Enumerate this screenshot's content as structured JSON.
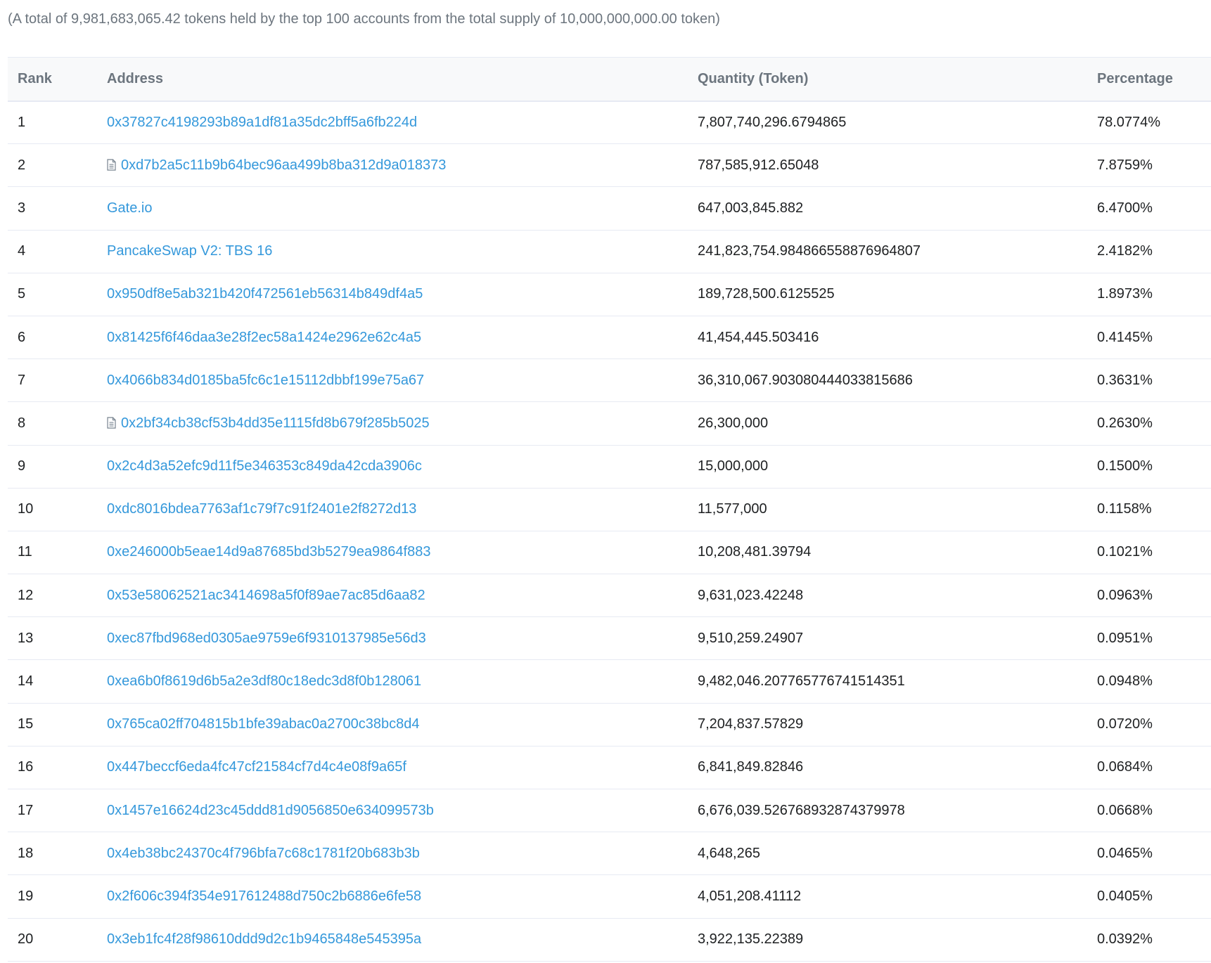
{
  "summary": "(A total of 9,981,683,065.42 tokens held by the top 100 accounts from the total supply of 10,000,000,000.00 token)",
  "table": {
    "headers": {
      "rank": "Rank",
      "address": "Address",
      "quantity": "Quantity (Token)",
      "percentage": "Percentage"
    },
    "rows": [
      {
        "rank": "1",
        "address": "0x37827c4198293b89a1df81a35dc2bff5a6fb224d",
        "contract": false,
        "quantity": "7,807,740,296.6794865",
        "percentage": "78.0774%"
      },
      {
        "rank": "2",
        "address": "0xd7b2a5c11b9b64bec96aa499b8ba312d9a018373",
        "contract": true,
        "quantity": "787,585,912.65048",
        "percentage": "7.8759%"
      },
      {
        "rank": "3",
        "address": "Gate.io",
        "contract": false,
        "quantity": "647,003,845.882",
        "percentage": "6.4700%"
      },
      {
        "rank": "4",
        "address": "PancakeSwap V2: TBS 16",
        "contract": false,
        "quantity": "241,823,754.984866558876964807",
        "percentage": "2.4182%"
      },
      {
        "rank": "5",
        "address": "0x950df8e5ab321b420f472561eb56314b849df4a5",
        "contract": false,
        "quantity": "189,728,500.6125525",
        "percentage": "1.8973%"
      },
      {
        "rank": "6",
        "address": "0x81425f6f46daa3e28f2ec58a1424e2962e62c4a5",
        "contract": false,
        "quantity": "41,454,445.503416",
        "percentage": "0.4145%"
      },
      {
        "rank": "7",
        "address": "0x4066b834d0185ba5fc6c1e15112dbbf199e75a67",
        "contract": false,
        "quantity": "36,310,067.903080444033815686",
        "percentage": "0.3631%"
      },
      {
        "rank": "8",
        "address": "0x2bf34cb38cf53b4dd35e1115fd8b679f285b5025",
        "contract": true,
        "quantity": "26,300,000",
        "percentage": "0.2630%"
      },
      {
        "rank": "9",
        "address": "0x2c4d3a52efc9d11f5e346353c849da42cda3906c",
        "contract": false,
        "quantity": "15,000,000",
        "percentage": "0.1500%"
      },
      {
        "rank": "10",
        "address": "0xdc8016bdea7763af1c79f7c91f2401e2f8272d13",
        "contract": false,
        "quantity": "11,577,000",
        "percentage": "0.1158%"
      },
      {
        "rank": "11",
        "address": "0xe246000b5eae14d9a87685bd3b5279ea9864f883",
        "contract": false,
        "quantity": "10,208,481.39794",
        "percentage": "0.1021%"
      },
      {
        "rank": "12",
        "address": "0x53e58062521ac3414698a5f0f89ae7ac85d6aa82",
        "contract": false,
        "quantity": "9,631,023.42248",
        "percentage": "0.0963%"
      },
      {
        "rank": "13",
        "address": "0xec87fbd968ed0305ae9759e6f9310137985e56d3",
        "contract": false,
        "quantity": "9,510,259.24907",
        "percentage": "0.0951%"
      },
      {
        "rank": "14",
        "address": "0xea6b0f8619d6b5a2e3df80c18edc3d8f0b128061",
        "contract": false,
        "quantity": "9,482,046.207765776741514351",
        "percentage": "0.0948%"
      },
      {
        "rank": "15",
        "address": "0x765ca02ff704815b1bfe39abac0a2700c38bc8d4",
        "contract": false,
        "quantity": "7,204,837.57829",
        "percentage": "0.0720%"
      },
      {
        "rank": "16",
        "address": "0x447beccf6eda4fc47cf21584cf7d4c4e08f9a65f",
        "contract": false,
        "quantity": "6,841,849.82846",
        "percentage": "0.0684%"
      },
      {
        "rank": "17",
        "address": "0x1457e16624d23c45ddd81d9056850e634099573b",
        "contract": false,
        "quantity": "6,676,039.526768932874379978",
        "percentage": "0.0668%"
      },
      {
        "rank": "18",
        "address": "0x4eb38bc24370c4f796bfa7c68c1781f20b683b3b",
        "contract": false,
        "quantity": "4,648,265",
        "percentage": "0.0465%"
      },
      {
        "rank": "19",
        "address": "0x2f606c394f354e917612488d750c2b6886e6fe58",
        "contract": false,
        "quantity": "4,051,208.41112",
        "percentage": "0.0405%"
      },
      {
        "rank": "20",
        "address": "0x3eb1fc4f28f98610ddd9d2c1b9465848e545395a",
        "contract": false,
        "quantity": "3,922,135.22389",
        "percentage": "0.0392%"
      }
    ]
  },
  "icons": {
    "contract": "contract-file-icon"
  },
  "colors": {
    "link": "#3498db",
    "muted": "#6c757e",
    "text": "#1e2022",
    "border": "#e7eaf3",
    "header_bg": "#f8f9fa"
  }
}
